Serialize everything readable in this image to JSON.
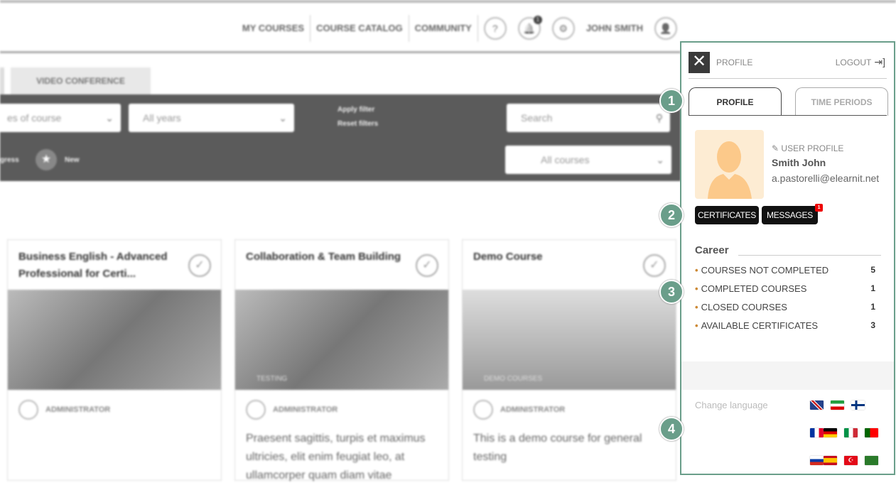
{
  "nav": {
    "items": [
      "MY COURSES",
      "COURSE CATALOG",
      "COMMUNITY"
    ],
    "help_icon": "question-icon",
    "notifications_count": "1",
    "settings_icon": "gear-icon",
    "user": "JOHN SMITH"
  },
  "tabs": {
    "video_conference": "VIDEO CONFERENCE"
  },
  "filters": {
    "type": "es of course",
    "years": "All years",
    "apply": "Apply filter",
    "reset": "Reset filters",
    "search_placeholder": "Search",
    "progress": "gress",
    "new": "New",
    "courses": "All courses"
  },
  "cards": [
    {
      "title": "Business English - Advanced Professional for Certi...",
      "category": "",
      "author": "ADMINISTRATOR",
      "desc": ""
    },
    {
      "title": "Collaboration & Team Building",
      "category": "TESTING",
      "author": "ADMINISTRATOR",
      "desc": "Praesent sagittis, turpis et maximus ultricies, elit enim feugiat leo, at ullamcorper quam diam vitae"
    },
    {
      "title": "Demo Course",
      "category": "DEMO COURSES",
      "author": "ADMINISTRATOR",
      "desc": "This is a demo course for general testing"
    }
  ],
  "panel": {
    "close_icon": "close-icon",
    "title": "PROFILE",
    "logout": "LOGOUT",
    "tabs": [
      "PROFILE",
      "TIME PERIODS"
    ],
    "user_profile_label": "USER PROFILE",
    "name": "Smith John",
    "email": "a.pastorelli@elearnit.net",
    "certificates": "CERTIFICATES",
    "messages": "MESSAGES",
    "messages_badge": "1",
    "career_title": "Career",
    "career": [
      {
        "label": "COURSES NOT COMPLETED",
        "value": "5"
      },
      {
        "label": "COMPLETED COURSES",
        "value": "1"
      },
      {
        "label": "CLOSED COURSES",
        "value": "1"
      },
      {
        "label": "AVAILABLE CERTIFICATES",
        "value": "3"
      }
    ],
    "change_language": "Change language",
    "flags": [
      "english",
      "persian",
      "finnish",
      "french",
      "german",
      "italian",
      "portuguese",
      "russian",
      "spanish",
      "turkish",
      "arabic"
    ]
  },
  "markers": [
    "1",
    "2",
    "3",
    "4"
  ],
  "accent": "#6a9e8a"
}
